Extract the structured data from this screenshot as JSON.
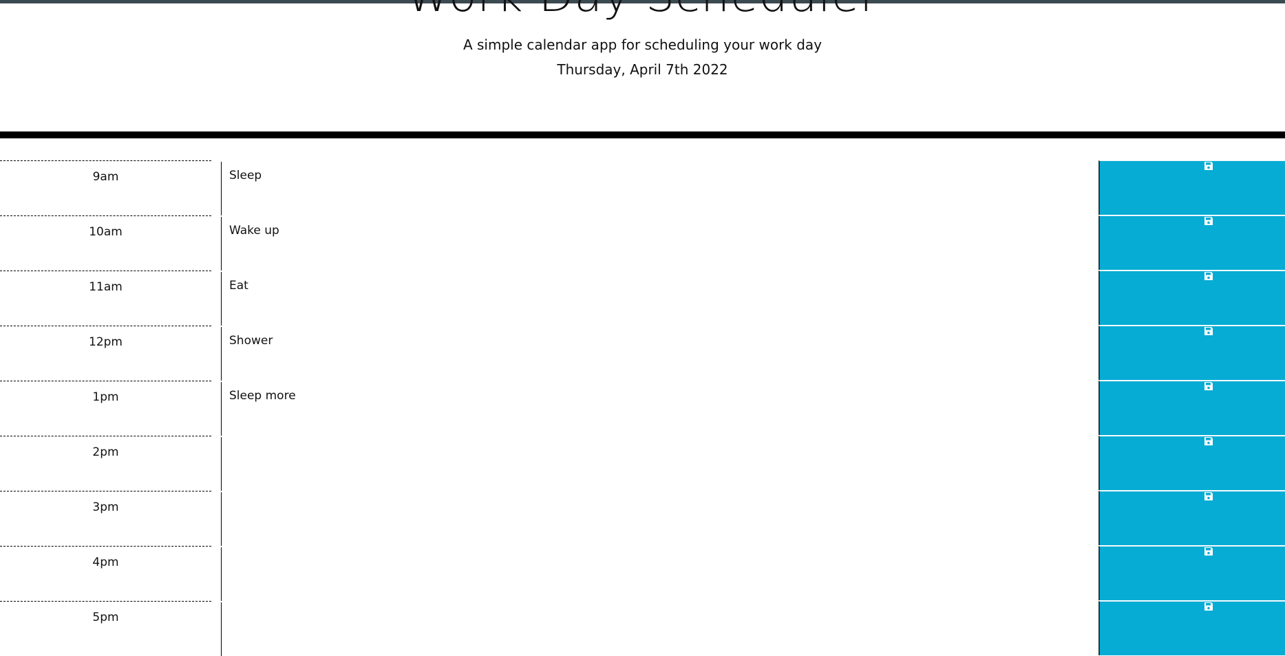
{
  "header": {
    "title": "Work Day Scheduler",
    "lead": "A simple calendar app for scheduling your work day",
    "current_day": "Thursday, April 7th 2022"
  },
  "schedule": [
    {
      "hour": "9am",
      "text": "Sleep"
    },
    {
      "hour": "10am",
      "text": "Wake up"
    },
    {
      "hour": "11am",
      "text": "Eat"
    },
    {
      "hour": "12pm",
      "text": "Shower"
    },
    {
      "hour": "1pm",
      "text": "Sleep more"
    },
    {
      "hour": "2pm",
      "text": ""
    },
    {
      "hour": "3pm",
      "text": ""
    },
    {
      "hour": "4pm",
      "text": ""
    },
    {
      "hour": "5pm",
      "text": ""
    }
  ],
  "colors": {
    "save_button": "#07acd4",
    "top_bar": "#3c4a52",
    "divider": "#000000"
  },
  "icons": {
    "save": "floppy-disk-icon"
  }
}
